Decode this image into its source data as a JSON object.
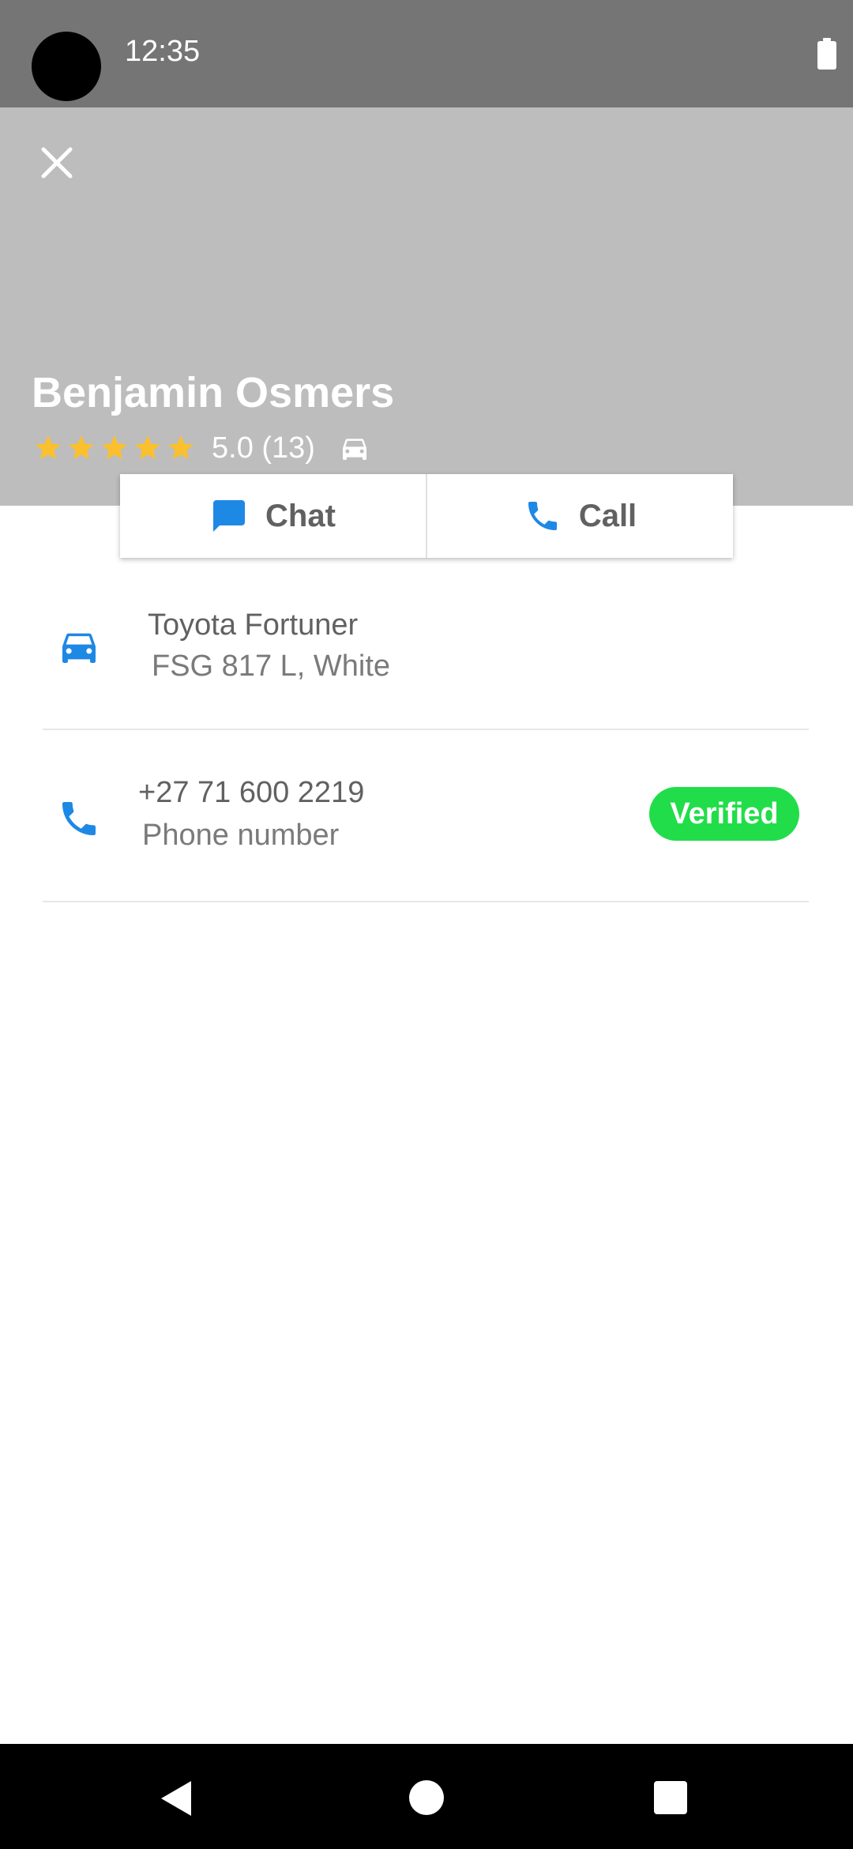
{
  "status_bar": {
    "time": "12:35",
    "icons": [
      "camera-cutout",
      "battery-icon"
    ]
  },
  "header": {
    "close_icon": "close-icon",
    "driver_name": "Benjamin Osmers",
    "rating": {
      "stars": 5,
      "max_stars": 5,
      "text": "5.0 (13)",
      "star_color": "#fbc02d"
    },
    "background_color": "#bdbdbd"
  },
  "actions": {
    "chat_label": "Chat",
    "call_label": "Call",
    "icon_color": "#1e88e5"
  },
  "vehicle": {
    "model": "Toyota Fortuner",
    "details": "FSG 817 L, White",
    "icon": "car-icon"
  },
  "phone": {
    "number": "+27 71 600 2219",
    "label": "Phone number",
    "badge": "Verified",
    "badge_color": "#22dd4a",
    "icon": "phone-icon"
  },
  "nav_bar": {
    "icons": [
      "back-icon",
      "home-icon",
      "recents-icon"
    ]
  }
}
